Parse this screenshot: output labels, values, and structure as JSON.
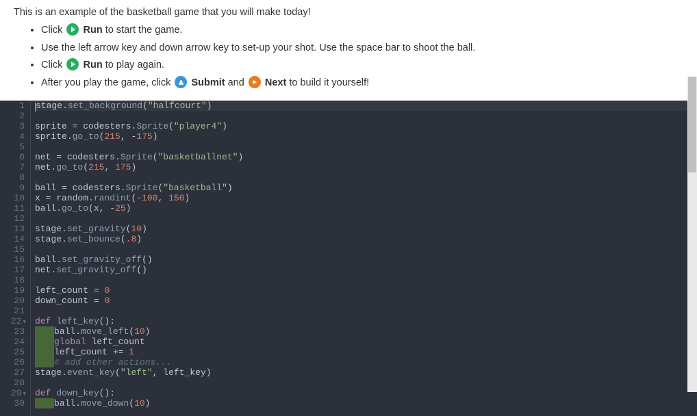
{
  "instructions": {
    "intro": "This is an example of the basketball game that you will make today!",
    "items": [
      {
        "pre": "Click ",
        "icon": "run",
        "bold": "Run",
        "post": " to start the game."
      },
      {
        "pre": "Use the left arrow key and down arrow key to set-up your shot. Use the space bar to shoot the ball.",
        "icon": null,
        "bold": "",
        "post": ""
      },
      {
        "pre": "Click ",
        "icon": "run",
        "bold": "Run",
        "post": " to play again."
      },
      {
        "pre": "After you play the game, click ",
        "icon": "submit",
        "bold": "Submit",
        "mid": " and ",
        "icon2": "next",
        "bold2": "Next",
        "post": " to build it yourself!"
      }
    ]
  },
  "code": {
    "lines": [
      {
        "n": 1,
        "active": true,
        "tokens": [
          [
            "var",
            "stage"
          ],
          [
            "punc",
            "."
          ],
          [
            "fn",
            "set_background"
          ],
          [
            "punc",
            "("
          ],
          [
            "str",
            "\"halfcourt\""
          ],
          [
            "punc",
            ")"
          ]
        ]
      },
      {
        "n": 2,
        "tokens": []
      },
      {
        "n": 3,
        "tokens": [
          [
            "var",
            "sprite "
          ],
          [
            "op",
            "="
          ],
          [
            "var",
            " codesters"
          ],
          [
            "punc",
            "."
          ],
          [
            "fn",
            "Sprite"
          ],
          [
            "punc",
            "("
          ],
          [
            "str",
            "\"player4\""
          ],
          [
            "punc",
            ")"
          ]
        ]
      },
      {
        "n": 4,
        "tokens": [
          [
            "var",
            "sprite"
          ],
          [
            "punc",
            "."
          ],
          [
            "fn",
            "go_to"
          ],
          [
            "punc",
            "("
          ],
          [
            "num",
            "215"
          ],
          [
            "punc",
            ", "
          ],
          [
            "op",
            "-"
          ],
          [
            "num",
            "175"
          ],
          [
            "punc",
            ")"
          ]
        ]
      },
      {
        "n": 5,
        "tokens": []
      },
      {
        "n": 6,
        "tokens": [
          [
            "var",
            "net "
          ],
          [
            "op",
            "="
          ],
          [
            "var",
            " codesters"
          ],
          [
            "punc",
            "."
          ],
          [
            "fn",
            "Sprite"
          ],
          [
            "punc",
            "("
          ],
          [
            "str",
            "\"basketballnet\""
          ],
          [
            "punc",
            ")"
          ]
        ]
      },
      {
        "n": 7,
        "tokens": [
          [
            "var",
            "net"
          ],
          [
            "punc",
            "."
          ],
          [
            "fn",
            "go_to"
          ],
          [
            "punc",
            "("
          ],
          [
            "num",
            "215"
          ],
          [
            "punc",
            ", "
          ],
          [
            "num",
            "175"
          ],
          [
            "punc",
            ")"
          ]
        ]
      },
      {
        "n": 8,
        "tokens": []
      },
      {
        "n": 9,
        "tokens": [
          [
            "var",
            "ball "
          ],
          [
            "op",
            "="
          ],
          [
            "var",
            " codesters"
          ],
          [
            "punc",
            "."
          ],
          [
            "fn",
            "Sprite"
          ],
          [
            "punc",
            "("
          ],
          [
            "str",
            "\"basketball\""
          ],
          [
            "punc",
            ")"
          ]
        ]
      },
      {
        "n": 10,
        "tokens": [
          [
            "var",
            "x "
          ],
          [
            "op",
            "="
          ],
          [
            "var",
            " random"
          ],
          [
            "punc",
            "."
          ],
          [
            "fn",
            "randint"
          ],
          [
            "punc",
            "("
          ],
          [
            "op",
            "-"
          ],
          [
            "num",
            "100"
          ],
          [
            "punc",
            ", "
          ],
          [
            "num",
            "150"
          ],
          [
            "punc",
            ")"
          ]
        ]
      },
      {
        "n": 11,
        "tokens": [
          [
            "var",
            "ball"
          ],
          [
            "punc",
            "."
          ],
          [
            "fn",
            "go_to"
          ],
          [
            "punc",
            "("
          ],
          [
            "var",
            "x"
          ],
          [
            "punc",
            ", "
          ],
          [
            "op",
            "-"
          ],
          [
            "num",
            "25"
          ],
          [
            "punc",
            ")"
          ]
        ]
      },
      {
        "n": 12,
        "tokens": []
      },
      {
        "n": 13,
        "tokens": [
          [
            "var",
            "stage"
          ],
          [
            "punc",
            "."
          ],
          [
            "fn",
            "set_gravity"
          ],
          [
            "punc",
            "("
          ],
          [
            "num",
            "10"
          ],
          [
            "punc",
            ")"
          ]
        ]
      },
      {
        "n": 14,
        "tokens": [
          [
            "var",
            "stage"
          ],
          [
            "punc",
            "."
          ],
          [
            "fn",
            "set_bounce"
          ],
          [
            "punc",
            "("
          ],
          [
            "num",
            ".8"
          ],
          [
            "punc",
            ")"
          ]
        ]
      },
      {
        "n": 15,
        "tokens": []
      },
      {
        "n": 16,
        "tokens": [
          [
            "var",
            "ball"
          ],
          [
            "punc",
            "."
          ],
          [
            "fn",
            "set_gravity_off"
          ],
          [
            "punc",
            "()"
          ]
        ]
      },
      {
        "n": 17,
        "tokens": [
          [
            "var",
            "net"
          ],
          [
            "punc",
            "."
          ],
          [
            "fn",
            "set_gravity_off"
          ],
          [
            "punc",
            "()"
          ]
        ]
      },
      {
        "n": 18,
        "tokens": []
      },
      {
        "n": 19,
        "tokens": [
          [
            "var",
            "left_count "
          ],
          [
            "op",
            "="
          ],
          [
            "var",
            " "
          ],
          [
            "num",
            "0"
          ]
        ]
      },
      {
        "n": 20,
        "tokens": [
          [
            "var",
            "down_count "
          ],
          [
            "op",
            "="
          ],
          [
            "var",
            " "
          ],
          [
            "num",
            "0"
          ]
        ]
      },
      {
        "n": 21,
        "tokens": []
      },
      {
        "n": 22,
        "fold": true,
        "tokens": [
          [
            "kw",
            "def"
          ],
          [
            "var",
            " "
          ],
          [
            "def",
            "left_key"
          ],
          [
            "punc",
            "():"
          ]
        ]
      },
      {
        "n": 23,
        "indent": true,
        "tokens": [
          [
            "var",
            "ball"
          ],
          [
            "punc",
            "."
          ],
          [
            "fn",
            "move_left"
          ],
          [
            "punc",
            "("
          ],
          [
            "num",
            "10"
          ],
          [
            "punc",
            ")"
          ]
        ]
      },
      {
        "n": 24,
        "indent": true,
        "tokens": [
          [
            "kw",
            "global"
          ],
          [
            "var",
            " left_count"
          ]
        ]
      },
      {
        "n": 25,
        "indent": true,
        "tokens": [
          [
            "var",
            "left_count "
          ],
          [
            "op",
            "+="
          ],
          [
            "var",
            " "
          ],
          [
            "num",
            "1"
          ]
        ]
      },
      {
        "n": 26,
        "indent": true,
        "tokens": [
          [
            "cmt",
            "# add other actions..."
          ]
        ]
      },
      {
        "n": 27,
        "tokens": [
          [
            "var",
            "stage"
          ],
          [
            "punc",
            "."
          ],
          [
            "fn",
            "event_key"
          ],
          [
            "punc",
            "("
          ],
          [
            "str",
            "\"left\""
          ],
          [
            "punc",
            ", "
          ],
          [
            "var",
            "left_key"
          ],
          [
            "punc",
            ")"
          ]
        ]
      },
      {
        "n": 28,
        "tokens": []
      },
      {
        "n": 29,
        "fold": true,
        "tokens": [
          [
            "kw",
            "def"
          ],
          [
            "var",
            " "
          ],
          [
            "def",
            "down_key"
          ],
          [
            "punc",
            "():"
          ]
        ]
      },
      {
        "n": 30,
        "indent": true,
        "tokens": [
          [
            "var",
            "ball"
          ],
          [
            "punc",
            "."
          ],
          [
            "fn",
            "move_down"
          ],
          [
            "punc",
            "("
          ],
          [
            "num",
            "10"
          ],
          [
            "punc",
            ")"
          ]
        ]
      }
    ]
  }
}
